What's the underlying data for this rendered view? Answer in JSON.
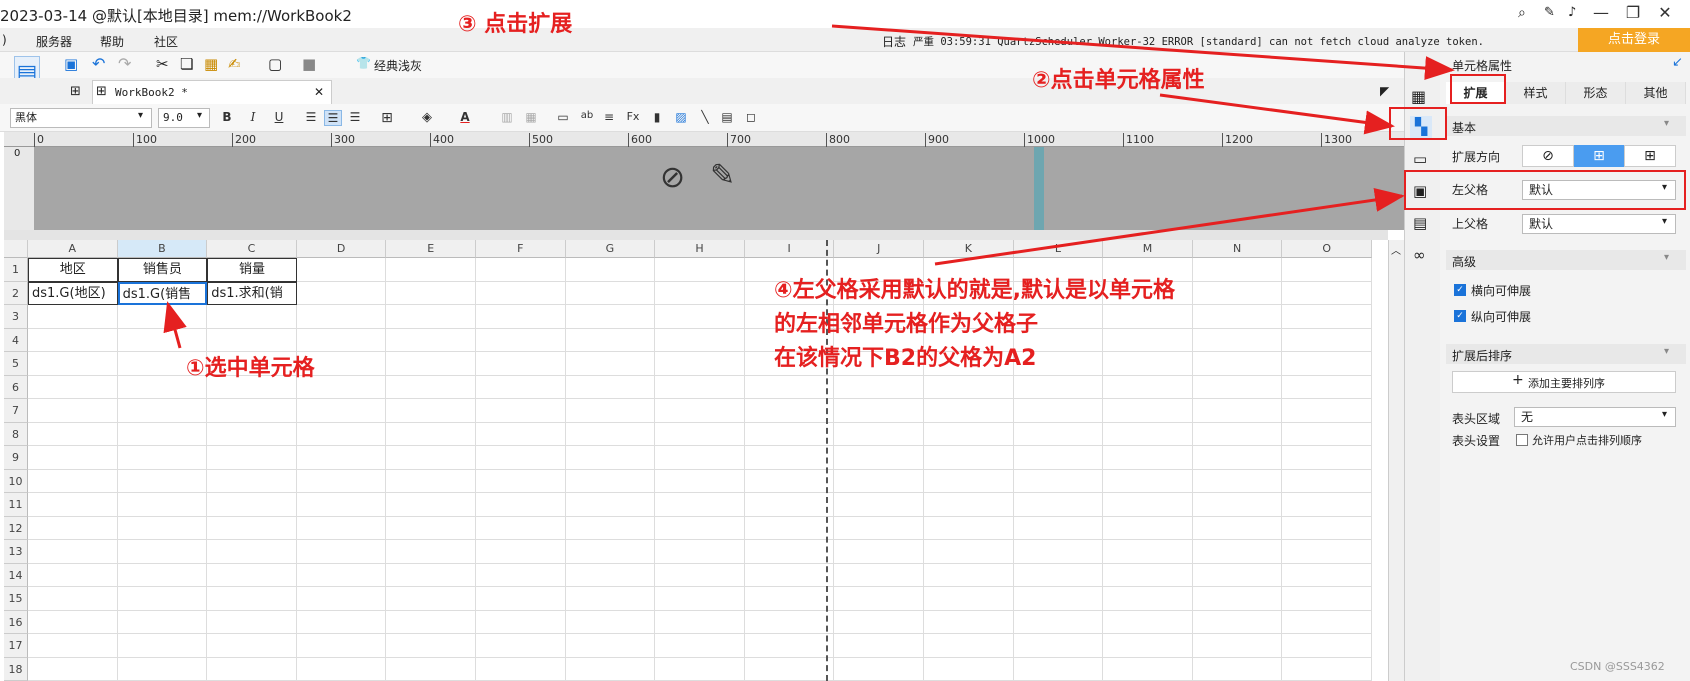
{
  "titlebar": {
    "title": "2023-03-14 @默认[本地目录]    mem://WorkBook2",
    "min": "—",
    "restore": "❐",
    "close": "✕"
  },
  "menu": {
    "items": [
      ")",
      "服务器",
      "帮助",
      "社区"
    ],
    "log_label": "日志",
    "log_text": "严重 03:59:31 QuartzScheduler Worker-32 ERROR [standard] can not fetch cloud analyze token.",
    "login": "点击登录"
  },
  "toolbar": {
    "theme_label": "经典浅灰"
  },
  "tab": {
    "name": "WorkBook2 *"
  },
  "format": {
    "font": "黑体",
    "size": "9.0"
  },
  "ruler": {
    "ticks": [
      "0",
      "100",
      "200",
      "300",
      "400",
      "500",
      "600",
      "700",
      "800",
      "900",
      "1000",
      "1100",
      "1200",
      "1300"
    ],
    "v": "0"
  },
  "grid": {
    "columns": [
      "A",
      "B",
      "C",
      "D",
      "E",
      "F",
      "G",
      "H",
      "I",
      "J",
      "K",
      "L",
      "M",
      "N",
      "O"
    ],
    "rows": [
      "1",
      "2",
      "3",
      "4",
      "5",
      "6",
      "7",
      "8",
      "9",
      "10",
      "11",
      "12",
      "13",
      "14",
      "15",
      "16",
      "17",
      "18"
    ],
    "row1": [
      "地区",
      "销售员",
      "销量"
    ],
    "row2": [
      "ds1.G(地区)",
      "ds1.G(销售",
      "ds1.求和(销"
    ]
  },
  "panel": {
    "title": "单元格属性",
    "tabs": [
      "扩展",
      "样式",
      "形态",
      "其他"
    ],
    "basic": "基本",
    "expand_dir": "扩展方向",
    "left_parent": "左父格",
    "left_parent_value": "默认",
    "top_parent": "上父格",
    "top_parent_value": "默认",
    "advanced": "高级",
    "h_expand": "横向可伸展",
    "v_expand": "纵向可伸展",
    "sort_after": "扩展后排序",
    "add_sort": "添加主要排列序",
    "header_area": "表头区域",
    "header_area_value": "无",
    "header_settings": "表头设置",
    "allow_sort": "允许用户点击排列顺序"
  },
  "annotations": {
    "a1": "①选中单元格",
    "a2": "②点击单元格属性",
    "a3": "③ 点击扩展",
    "a4_l1": "④左父格采用默认的就是,默认是以单元格",
    "a4_l2": "的左相邻单元格作为父格子",
    "a4_l3": "在该情况下B2的父格为A2"
  },
  "watermark": "CSDN @SSS4362",
  "colors": {
    "accent": "#1a73d9",
    "annotation": "#e52020",
    "login": "#f5a623"
  }
}
